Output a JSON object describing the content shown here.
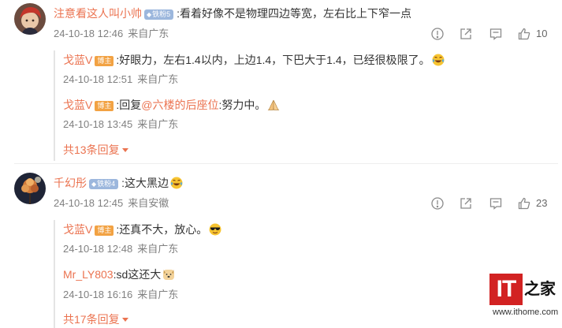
{
  "comments": [
    {
      "author": "注意看这人叫小帅",
      "fan_badge": "铁粉5",
      "text": ":看着好像不是物理四边等宽，左右比上下窄一点",
      "time": "24-10-18 12:46",
      "location": "来自广东",
      "likes": "10",
      "replies": [
        {
          "author": "戈蓝V",
          "badge": "博主",
          "text": ":好眼力，左右1.4以内，上边1.4，下巴大于1.4，已经很极限了。",
          "emoji": "laugh-cry-emoji",
          "time": "24-10-18 12:51",
          "location": "来自广东"
        },
        {
          "author": "戈蓝V",
          "badge": "博主",
          "text_prefix": ":回复",
          "mention": "@六楼的后座位",
          "text": ":努力中。",
          "emoji": "praying-hands-emoji",
          "time": "24-10-18 13:45",
          "location": "来自广东"
        }
      ],
      "more_replies": "共13条回复"
    },
    {
      "author": "千幻彤",
      "fan_badge": "铁粉4",
      "text": ":这大黑边",
      "emoji": "laugh-cry-emoji",
      "time": "24-10-18 12:45",
      "location": "来自安徽",
      "likes": "23",
      "replies": [
        {
          "author": "戈蓝V",
          "badge": "博主",
          "text": ":还真不大，放心。",
          "emoji": "cool-sunglasses-emoji",
          "time": "24-10-18 12:48",
          "location": "来自广东"
        },
        {
          "author": "Mr_LY803",
          "text": ":sd这还大",
          "emoji": "doge-emoji",
          "time": "24-10-18 16:16",
          "location": "来自广东"
        }
      ],
      "more_replies": "共17条回复"
    }
  ],
  "action_icons": [
    "alert-icon",
    "share-icon",
    "comment-icon",
    "like-icon"
  ],
  "watermark": {
    "logo_left": "IT",
    "logo_right": "之家",
    "url": "www.ithome.com"
  },
  "colors": {
    "name": "#eb7350",
    "text": "#333333",
    "meta": "#808080",
    "fan_badge": "#9cb7dd",
    "host_badge": "#f2a243",
    "logo_red": "#d22222"
  }
}
